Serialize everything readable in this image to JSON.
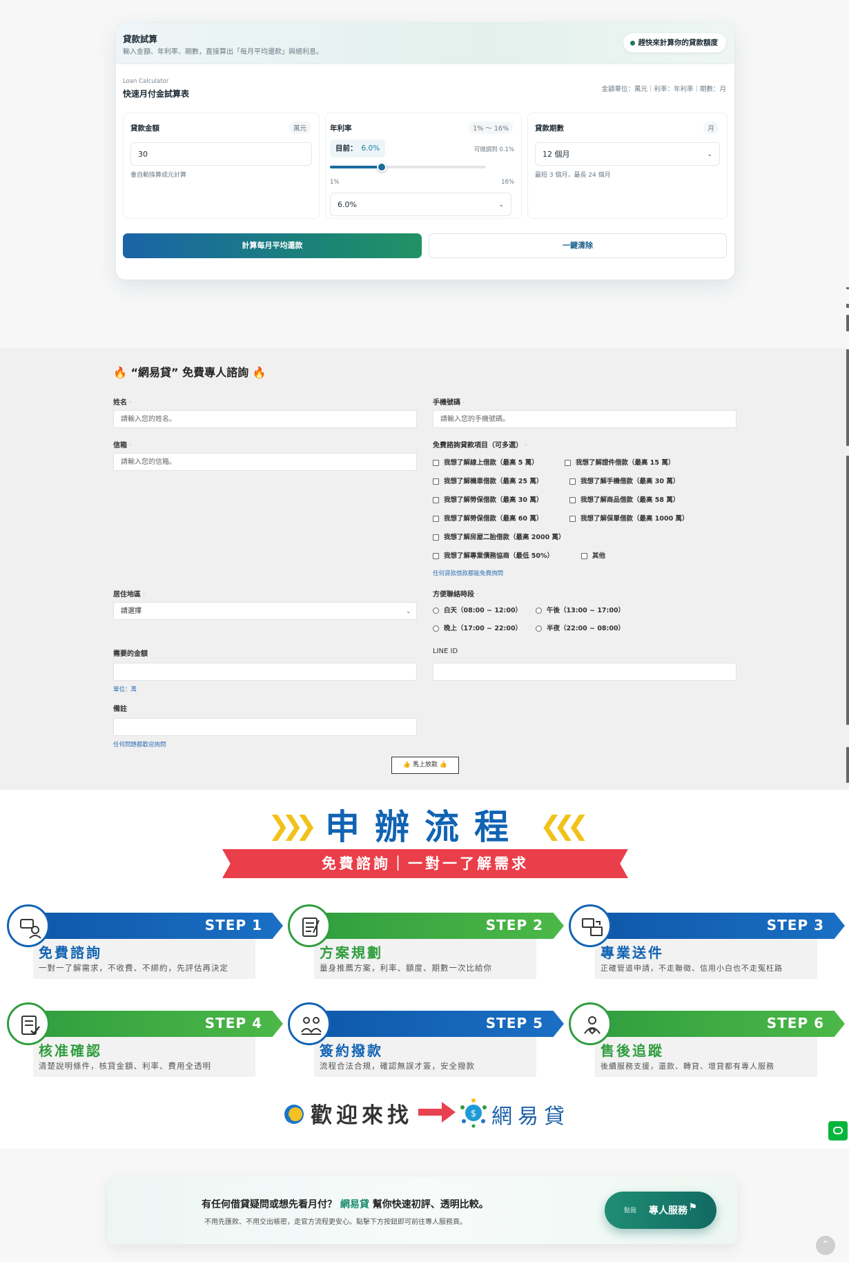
{
  "calculator": {
    "title": "貸款試算",
    "subtitle": "輸入金額、年利率、期數，直接算出「每月平均還款」與總利息。",
    "badge": "趕快來計算你的貸款額度",
    "en_label": "Loan Calculator",
    "table_title": "快速月付金試算表",
    "units_note": "金額單位：萬元｜利率：年利率｜期數：月",
    "amount": {
      "label": "貸款金額",
      "unit": "萬元",
      "value": "30",
      "hint": "會自動換算成元計算"
    },
    "rate": {
      "label": "年利率",
      "range": "1% ～ 16%",
      "current_label": "目前：",
      "current_value": "6.0%",
      "step_hint": "可微調到 0.1%",
      "min_label": "1%",
      "max_label": "16%",
      "min": 1,
      "max": 16,
      "value": 6.0,
      "select_value": "6.0%"
    },
    "term": {
      "label": "貸款期數",
      "unit": "月",
      "value": "12 個月",
      "hint": "最短 3 個月，最長 24 個月"
    },
    "calc_button": "計算每月平均還款",
    "clear_button": "一鍵清除"
  },
  "form": {
    "title": "“網易貸” 免費專人諮詢",
    "name_label": "姓名",
    "name_placeholder": "請輸入您的姓名。",
    "phone_label": "手機號碼",
    "phone_placeholder": "請輸入您的手機號碼。",
    "email_label": "信箱",
    "email_placeholder": "請輸入您的信箱。",
    "items_label": "免費諮詢貸款項目（可多選）",
    "items": [
      "我想了解線上借款（最高 5 萬）",
      "我想了解證件借款（最高 15 萬）",
      "我想了解機車借款（最高 25 萬）",
      "我想了解手機借款（最高 30 萬）",
      "我想了解勞保借款（最高 30 萬）",
      "我想了解商品借款（最高 58 萬）",
      "我想了解勞保借款（最高 60 萬）",
      "我想了解保單借款（最高 1000 萬）",
      "我想了解房屋二胎借款（最高 2000 萬）",
      "我想了解專業債務協商（最低 50%）",
      "其他"
    ],
    "items_note": "任何貸款借款都能免費詢問",
    "region_label": "居住地區",
    "region_value": "請選擇",
    "time_label": "方便聯絡時段",
    "times": [
      "白天（08:00 ~ 12:00）",
      "午後（13:00 ~ 17:00）",
      "晚上（17:00 ~ 22:00）",
      "半夜（22:00 ~ 08:00）"
    ],
    "amount_label": "需要的金額",
    "amount_note": "單位：萬",
    "line_label": "LINE ID",
    "remark_label": "備註",
    "remark_note": "任何問題都歡迎詢問",
    "submit": "👍 馬上放款 👍"
  },
  "process": {
    "title": "申辦流程",
    "ribbon": "免費諮詢｜一對一了解需求",
    "steps": [
      {
        "num": "STEP 1",
        "name": "免費諮詢",
        "desc": "一對一了解需求，不收費、不綁約，先評估再決定"
      },
      {
        "num": "STEP 2",
        "name": "方案規劃",
        "desc": "量身推薦方案，利率、額度、期數一次比給你"
      },
      {
        "num": "STEP 3",
        "name": "專業送件",
        "desc": "正確管道申請，不走聯徵、信用小白也不走冤枉路"
      },
      {
        "num": "STEP 4",
        "name": "核准確認",
        "desc": "清楚說明條件，核貸金額、利率、費用全透明"
      },
      {
        "num": "STEP 5",
        "name": "簽約撥款",
        "desc": "流程合法合規，確認無誤才簽，安全撥款"
      },
      {
        "num": "STEP 6",
        "name": "售後追蹤",
        "desc": "後續服務支援，還款、轉貸、增貸都有專人服務"
      }
    ],
    "welcome_text": "歡迎來找",
    "welcome_brand": "網易貸"
  },
  "cta": {
    "main_prefix": "有任何借貸疑問或想先看月付？",
    "brand": "網易貸",
    "main_suffix": "幫你快速初評、透明比較。",
    "sub": "不用先匯款、不用交出帳密，走官方流程更安心。點擊下方按鈕即可前往專人服務頁。",
    "button_tag": "點我",
    "button_label": "專人服務",
    "button_icon": "⚑"
  },
  "colors": {
    "primary": "#1163b3",
    "green": "#2f9d3e",
    "red": "#ea3e4a",
    "teal": "#1b8574"
  }
}
